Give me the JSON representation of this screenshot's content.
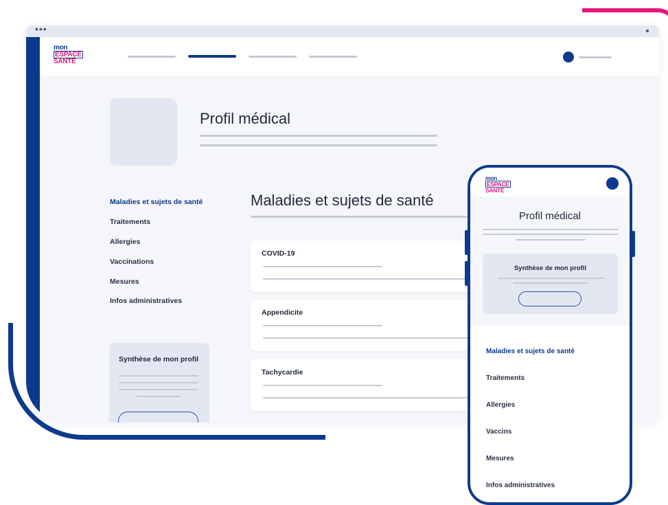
{
  "brand": {
    "logo_line1": "mon",
    "logo_line2": "ESPACE",
    "logo_line3": "SANTÉ",
    "primary_color": "#0d3a8e",
    "accent_color": "#e2187c"
  },
  "window": {
    "dots": "•••"
  },
  "desktop": {
    "page_title": "Profil médical",
    "sidebar": {
      "items": [
        {
          "label": "Maladies et sujets de santé",
          "active": true
        },
        {
          "label": "Traitements"
        },
        {
          "label": "Allergies"
        },
        {
          "label": "Vaccinations"
        },
        {
          "label": "Mesures"
        },
        {
          "label": "Infos administratives"
        }
      ]
    },
    "synthesis": {
      "title": "Synthèse de mon profil"
    },
    "section_title": "Maladies et sujets de santé",
    "cards": [
      {
        "title": "COVID-19"
      },
      {
        "title": "Appendicite"
      },
      {
        "title": "Tachycardie"
      }
    ]
  },
  "mobile": {
    "page_title": "Profil médical",
    "synthesis": {
      "title": "Synthèse de mon profil"
    },
    "menu": {
      "items": [
        {
          "label": "Maladies et sujets de santé",
          "active": true
        },
        {
          "label": "Traitements"
        },
        {
          "label": "Allergies"
        },
        {
          "label": "Vaccins"
        },
        {
          "label": "Mesures"
        },
        {
          "label": "Infos administratives"
        }
      ]
    }
  }
}
